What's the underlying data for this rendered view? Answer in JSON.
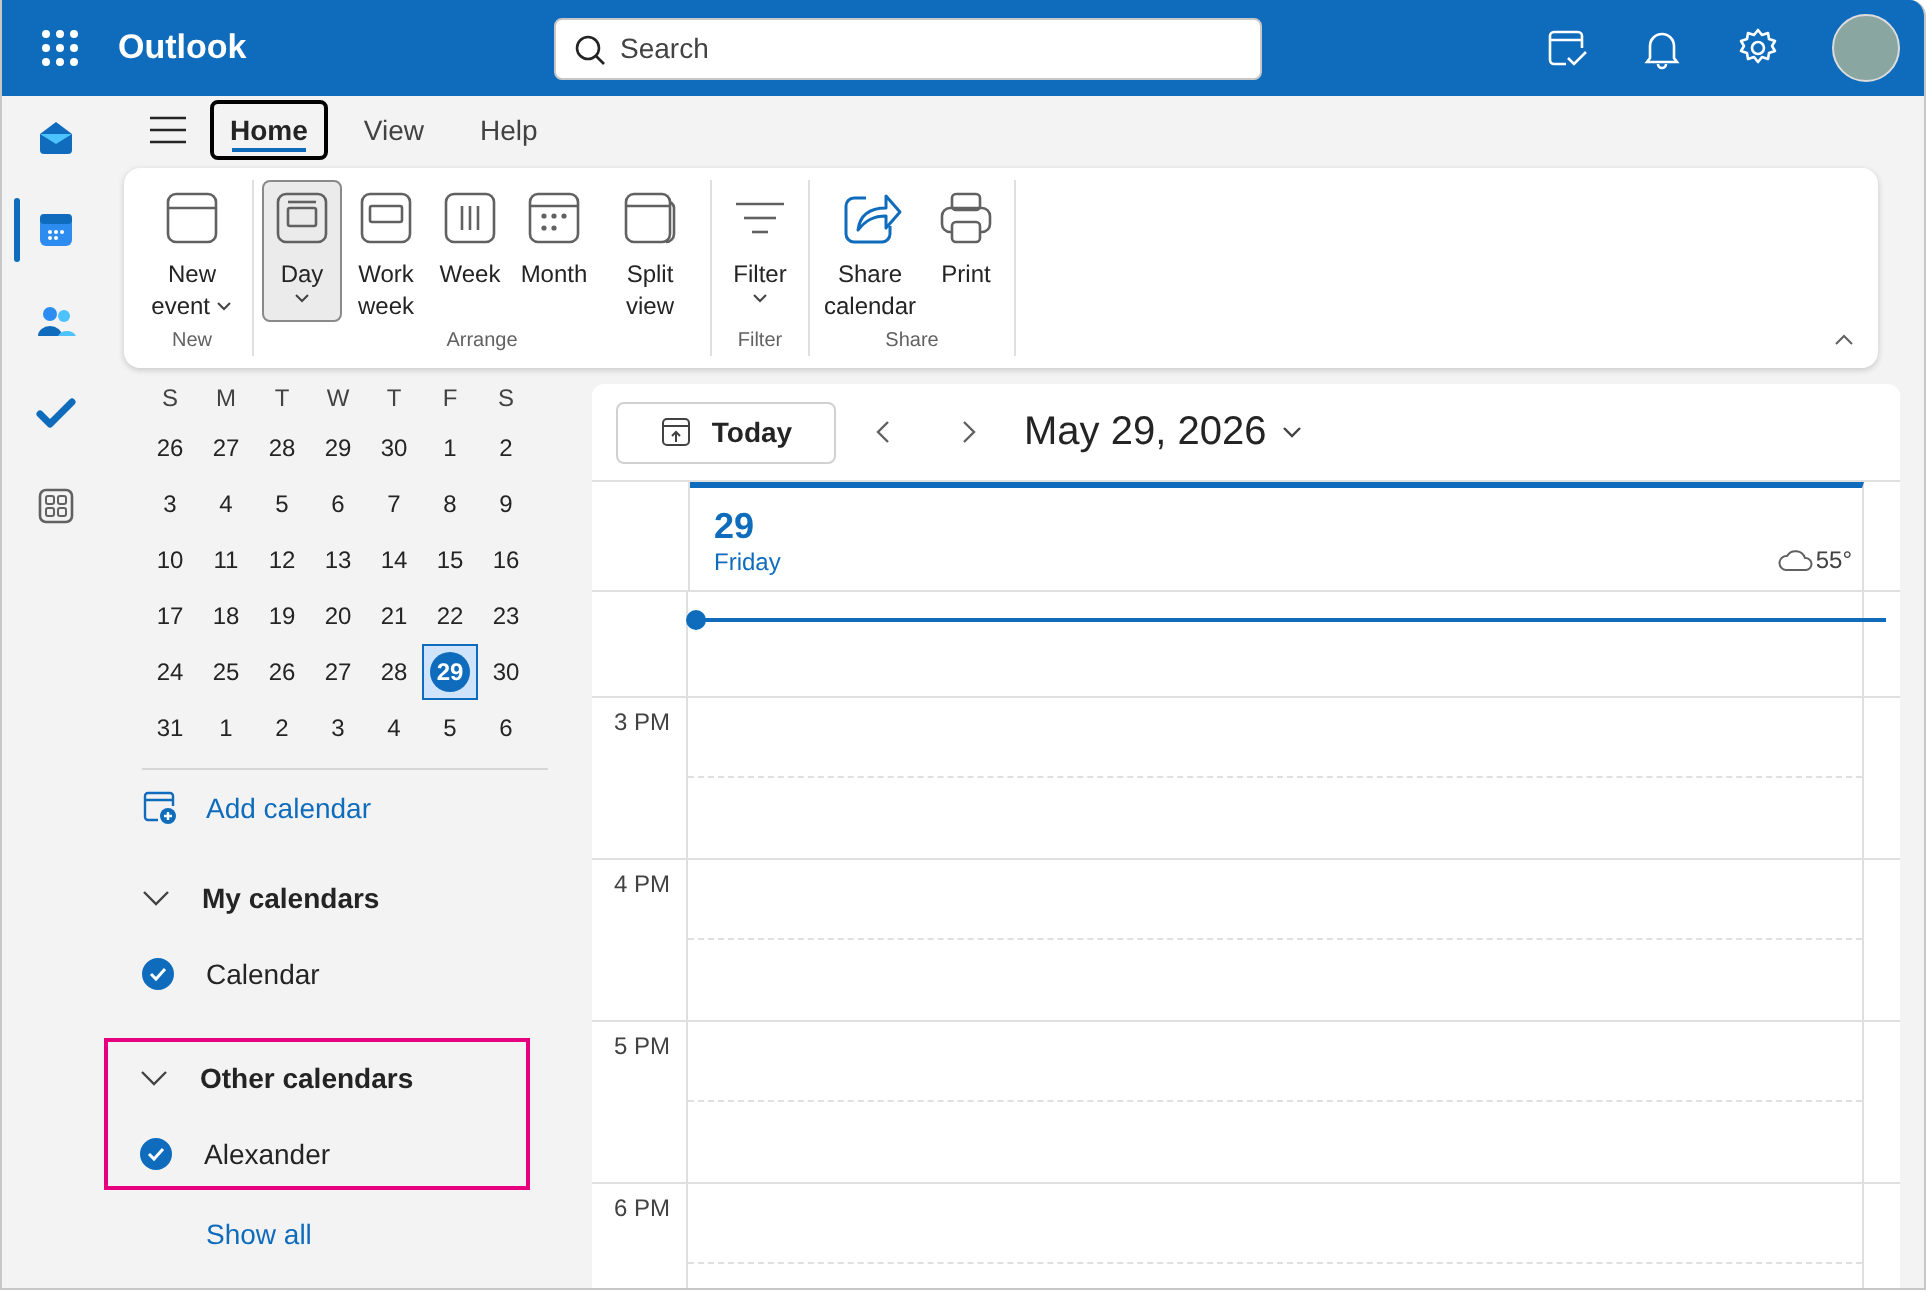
{
  "header": {
    "app_name": "Outlook",
    "search": {
      "placeholder": "Search"
    }
  },
  "nav_rail": [
    {
      "selected": false
    },
    {
      "selected": true
    },
    {
      "selected": false
    },
    {
      "selected": false
    },
    {
      "selected": false
    }
  ],
  "tabs": [
    {
      "label": "Home",
      "selected": true
    },
    {
      "label": "View",
      "selected": false
    },
    {
      "label": "Help",
      "selected": false
    }
  ],
  "ribbon": {
    "groups": [
      {
        "label": "New",
        "buttons": [
          {
            "label": "New event",
            "dropdown": true,
            "selected": false
          }
        ]
      },
      {
        "label": "Arrange",
        "buttons": [
          {
            "label": "Day",
            "split": true,
            "selected": true
          },
          {
            "label": "Work week",
            "selected": false
          },
          {
            "label": "Week",
            "selected": false
          },
          {
            "label": "Month",
            "selected": false
          },
          {
            "label": "Split view",
            "selected": false
          }
        ]
      },
      {
        "label": "Filter",
        "buttons": [
          {
            "label": "Filter",
            "split": true,
            "selected": false
          }
        ]
      },
      {
        "label": "Share",
        "buttons": [
          {
            "label": "Share calendar",
            "selected": false
          },
          {
            "label": "Print",
            "selected": false
          }
        ]
      }
    ]
  },
  "mini_calendar": {
    "weekdays": [
      "S",
      "M",
      "T",
      "W",
      "T",
      "F",
      "S"
    ],
    "weeks": [
      [
        {
          "day": "26",
          "selected": false
        },
        {
          "day": "27",
          "selected": false
        },
        {
          "day": "28",
          "selected": false
        },
        {
          "day": "29",
          "selected": false
        },
        {
          "day": "30",
          "selected": false
        },
        {
          "day": "1",
          "selected": false
        },
        {
          "day": "2",
          "selected": false
        }
      ],
      [
        {
          "day": "3",
          "selected": false
        },
        {
          "day": "4",
          "selected": false
        },
        {
          "day": "5",
          "selected": false
        },
        {
          "day": "6",
          "selected": false
        },
        {
          "day": "7",
          "selected": false
        },
        {
          "day": "8",
          "selected": false
        },
        {
          "day": "9",
          "selected": false
        }
      ],
      [
        {
          "day": "10",
          "selected": false
        },
        {
          "day": "11",
          "selected": false
        },
        {
          "day": "12",
          "selected": false
        },
        {
          "day": "13",
          "selected": false
        },
        {
          "day": "14",
          "selected": false
        },
        {
          "day": "15",
          "selected": false
        },
        {
          "day": "16",
          "selected": false
        }
      ],
      [
        {
          "day": "17",
          "selected": false
        },
        {
          "day": "18",
          "selected": false
        },
        {
          "day": "19",
          "selected": false
        },
        {
          "day": "20",
          "selected": false
        },
        {
          "day": "21",
          "selected": false
        },
        {
          "day": "22",
          "selected": false
        },
        {
          "day": "23",
          "selected": false
        }
      ],
      [
        {
          "day": "24",
          "selected": false
        },
        {
          "day": "25",
          "selected": false
        },
        {
          "day": "26",
          "selected": false
        },
        {
          "day": "27",
          "selected": false
        },
        {
          "day": "28",
          "selected": false
        },
        {
          "day": "29",
          "selected": true
        },
        {
          "day": "30",
          "selected": false
        }
      ],
      [
        {
          "day": "31",
          "selected": false
        },
        {
          "day": "1",
          "selected": false
        },
        {
          "day": "2",
          "selected": false
        },
        {
          "day": "3",
          "selected": false
        },
        {
          "day": "4",
          "selected": false
        },
        {
          "day": "5",
          "selected": false
        },
        {
          "day": "6",
          "selected": false
        }
      ]
    ]
  },
  "add_calendar": "Add calendar",
  "calendar_groups": [
    {
      "title": "My calendars",
      "expanded": true,
      "highlighted": false,
      "items": [
        {
          "name": "Calendar",
          "checked": true
        }
      ]
    },
    {
      "title": "Other calendars",
      "expanded": true,
      "highlighted": true,
      "items": [
        {
          "name": "Alexander",
          "checked": true
        }
      ]
    }
  ],
  "show_all": "Show all",
  "day_view": {
    "today_button": "Today",
    "title": "May 29, 2026",
    "day_number": "29",
    "day_name": "Friday",
    "weather": "55°",
    "hours": [
      "3 PM",
      "4 PM",
      "5 PM",
      "6 PM"
    ]
  }
}
